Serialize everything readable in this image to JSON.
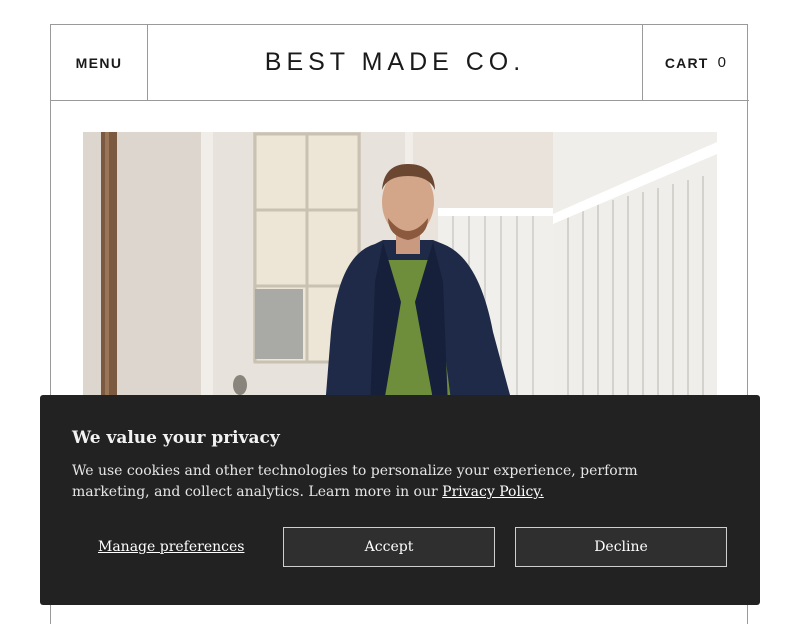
{
  "header": {
    "menu_label": "MENU",
    "brand": "BEST MADE CO.",
    "cart_label": "CART",
    "cart_count": "0"
  },
  "consent": {
    "title": "We value your privacy",
    "body": "We use cookies and other technologies to personalize your experience, perform marketing, and collect analytics. Learn more in our ",
    "policy_link": "Privacy Policy.",
    "manage_label": "Manage preferences",
    "accept_label": "Accept",
    "decline_label": "Decline"
  },
  "colors": {
    "banner_bg": "#222222",
    "border": "#9a9a9a",
    "text_dark": "#1a1a1a"
  }
}
